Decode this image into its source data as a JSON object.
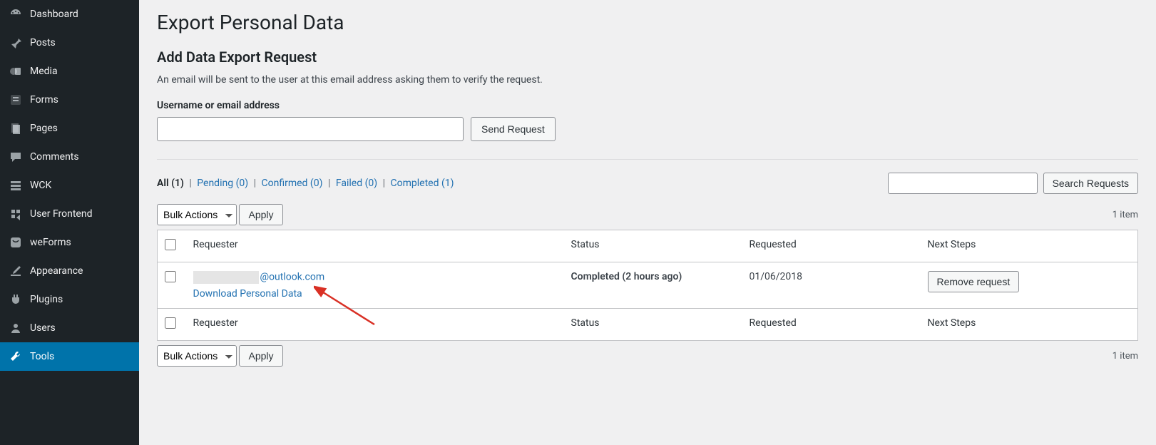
{
  "sidebar": {
    "items": [
      {
        "label": "Dashboard",
        "icon": "dashboard"
      },
      {
        "label": "Posts",
        "icon": "pin"
      },
      {
        "label": "Media",
        "icon": "media"
      },
      {
        "label": "Forms",
        "icon": "forms"
      },
      {
        "label": "Pages",
        "icon": "pages"
      },
      {
        "label": "Comments",
        "icon": "comments"
      },
      {
        "label": "WCK",
        "icon": "wck"
      },
      {
        "label": "User Frontend",
        "icon": "userfrontend"
      },
      {
        "label": "weForms",
        "icon": "weforms"
      },
      {
        "label": "Appearance",
        "icon": "appearance"
      },
      {
        "label": "Plugins",
        "icon": "plugins"
      },
      {
        "label": "Users",
        "icon": "users"
      },
      {
        "label": "Tools",
        "icon": "tools",
        "active": true
      }
    ]
  },
  "page": {
    "title": "Export Personal Data",
    "subtitle": "Add Data Export Request",
    "description": "An email will be sent to the user at this email address asking them to verify the request.",
    "form_label": "Username or email address",
    "send_button": "Send Request"
  },
  "filters": {
    "all": {
      "label": "All",
      "count": "(1)"
    },
    "pending": {
      "label": "Pending",
      "count": "(0)"
    },
    "confirmed": {
      "label": "Confirmed",
      "count": "(0)"
    },
    "failed": {
      "label": "Failed",
      "count": "(0)"
    },
    "completed": {
      "label": "Completed",
      "count": "(1)"
    }
  },
  "search": {
    "button": "Search Requests"
  },
  "bulk": {
    "label": "Bulk Actions",
    "apply": "Apply"
  },
  "pagination": {
    "count_top": "1 item",
    "count_bottom": "1 item"
  },
  "table": {
    "headers": {
      "requester": "Requester",
      "status": "Status",
      "requested": "Requested",
      "next_steps": "Next Steps"
    },
    "rows": [
      {
        "email_suffix": "@outlook.com",
        "row_action": "Download Personal Data",
        "status": "Completed (2 hours ago)",
        "requested": "01/06/2018",
        "next_steps_button": "Remove request"
      }
    ]
  }
}
